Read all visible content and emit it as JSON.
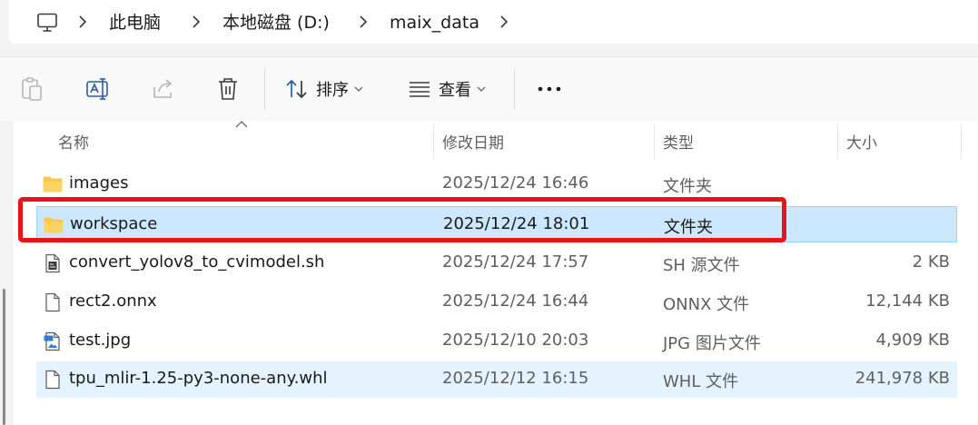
{
  "breadcrumb": {
    "items": [
      "此电脑",
      "本地磁盘 (D:)",
      "maix_data"
    ]
  },
  "toolbar": {
    "sort_label": "排序",
    "view_label": "查看"
  },
  "columns": {
    "name": "名称",
    "modified": "修改日期",
    "type": "类型",
    "size": "大小"
  },
  "files": [
    {
      "name": "images",
      "modified": "2025/12/24 16:46",
      "type": "文件夹",
      "size": "",
      "icon": "folder-icon"
    },
    {
      "name": "workspace",
      "modified": "2025/12/24 18:01",
      "type": "文件夹",
      "size": "",
      "icon": "folder-icon",
      "state": "selected"
    },
    {
      "name": "convert_yolov8_to_cvimodel.sh",
      "modified": "2025/12/24 17:57",
      "type": "SH 源文件",
      "size": "2 KB",
      "icon": "script-file-icon"
    },
    {
      "name": "rect2.onnx",
      "modified": "2025/12/24 16:44",
      "type": "ONNX 文件",
      "size": "12,144 KB",
      "icon": "file-icon"
    },
    {
      "name": "test.jpg",
      "modified": "2025/12/10 20:03",
      "type": "JPG 图片文件",
      "size": "4,909 KB",
      "icon": "image-file-icon"
    },
    {
      "name": "tpu_mlir-1.25-py3-none-any.whl",
      "modified": "2025/12/12 16:15",
      "type": "WHL 文件",
      "size": "241,978 KB",
      "icon": "file-icon",
      "state": "hover"
    }
  ],
  "colors": {
    "selected_bg": "#cce8ff",
    "hover_bg": "#e5f3ff",
    "annotation": "#e8141a",
    "folder": "#f8c948"
  }
}
